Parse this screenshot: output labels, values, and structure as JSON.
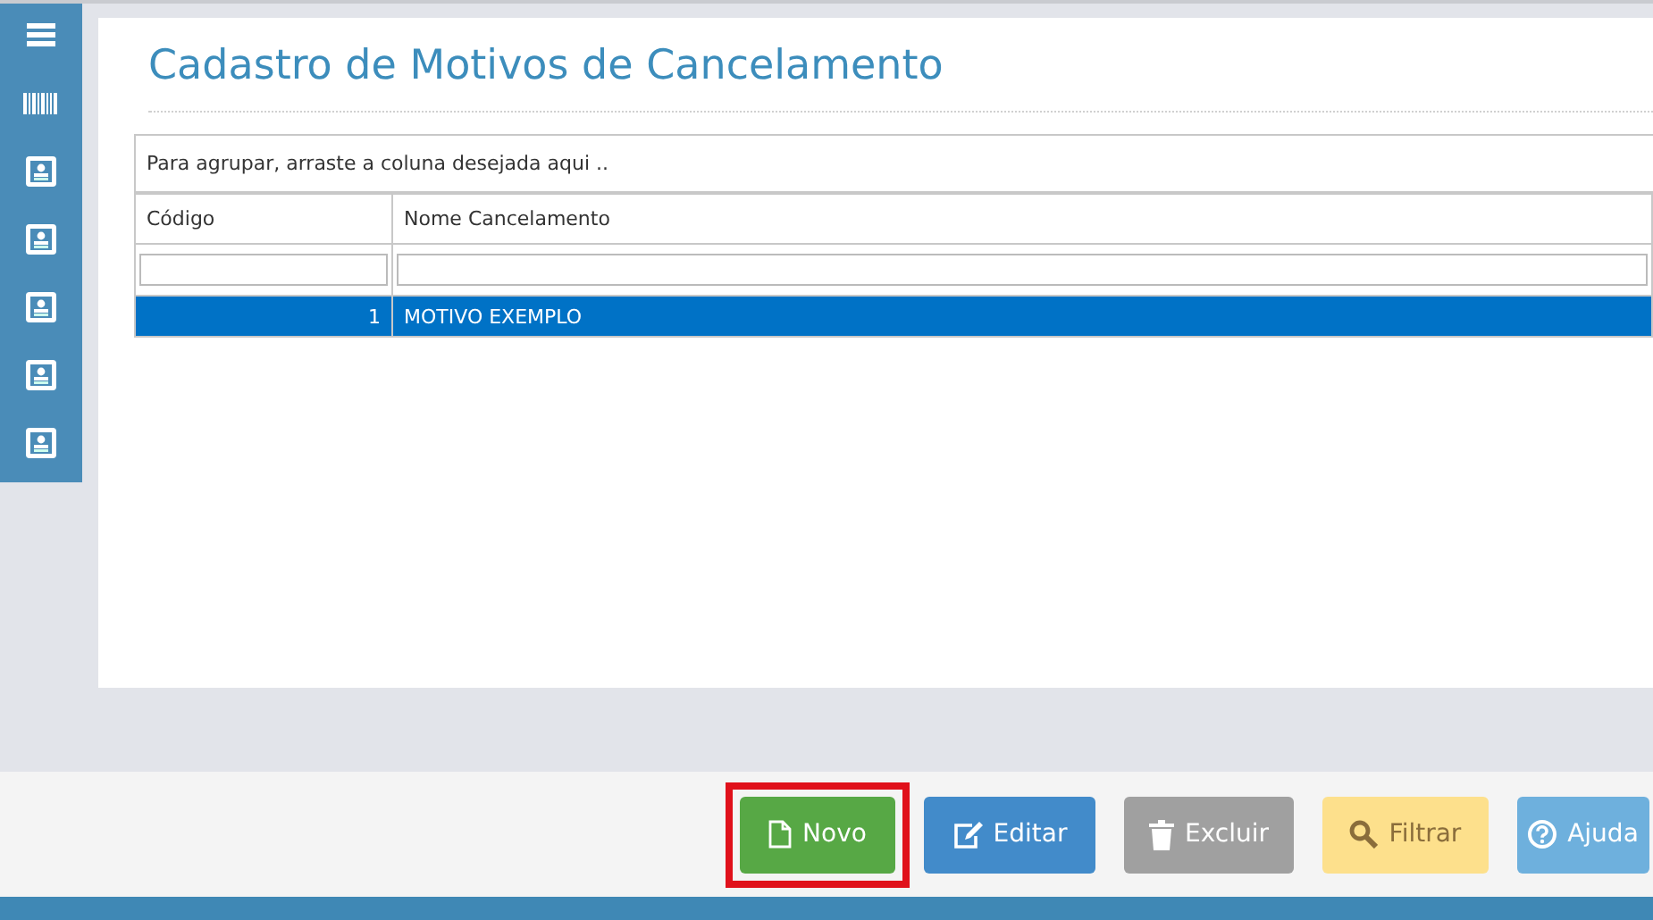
{
  "sidebar": {
    "items": [
      {
        "kind": "menu"
      },
      {
        "kind": "barcode"
      },
      {
        "kind": "card"
      },
      {
        "kind": "card"
      },
      {
        "kind": "card"
      },
      {
        "kind": "card"
      },
      {
        "kind": "card"
      }
    ]
  },
  "page": {
    "title": "Cadastro de Motivos de Cancelamento"
  },
  "grid": {
    "group_hint": "Para agrupar, arraste a coluna desejada aqui ..",
    "columns": [
      "Código",
      "Nome Cancelamento"
    ],
    "rows": [
      {
        "cells": [
          "1",
          "MOTIVO EXEMPLO"
        ],
        "selected": true
      }
    ]
  },
  "buttons": [
    {
      "label": "Novo",
      "kind": "new",
      "highlighted": true
    },
    {
      "label": "Editar",
      "kind": "edit",
      "highlighted": false
    },
    {
      "label": "Excluir",
      "kind": "delete",
      "highlighted": false
    },
    {
      "label": "Filtrar",
      "kind": "filter",
      "highlighted": false
    },
    {
      "label": "Ajuda",
      "kind": "help",
      "highlighted": false
    }
  ]
}
